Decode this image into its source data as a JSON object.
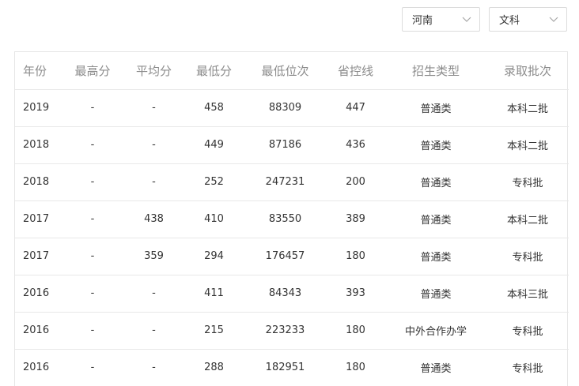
{
  "filters": {
    "province": "河南",
    "subject": "文科"
  },
  "table": {
    "headers": [
      "年份",
      "最高分",
      "平均分",
      "最低分",
      "最低位次",
      "省控线",
      "招生类型",
      "录取批次"
    ],
    "rows": [
      [
        "2019",
        "-",
        "-",
        "458",
        "88309",
        "447",
        "普通类",
        "本科二批"
      ],
      [
        "2018",
        "-",
        "-",
        "449",
        "87186",
        "436",
        "普通类",
        "本科二批"
      ],
      [
        "2018",
        "-",
        "-",
        "252",
        "247231",
        "200",
        "普通类",
        "专科批"
      ],
      [
        "2017",
        "-",
        "438",
        "410",
        "83550",
        "389",
        "普通类",
        "本科二批"
      ],
      [
        "2017",
        "-",
        "359",
        "294",
        "176457",
        "180",
        "普通类",
        "专科批"
      ],
      [
        "2016",
        "-",
        "-",
        "411",
        "84343",
        "393",
        "普通类",
        "本科三批"
      ],
      [
        "2016",
        "-",
        "-",
        "215",
        "223233",
        "180",
        "中外合作办学",
        "专科批"
      ],
      [
        "2016",
        "-",
        "-",
        "288",
        "182951",
        "180",
        "普通类",
        "专科批"
      ]
    ]
  },
  "icons": {
    "dropdown": "chevron-down-icon"
  }
}
